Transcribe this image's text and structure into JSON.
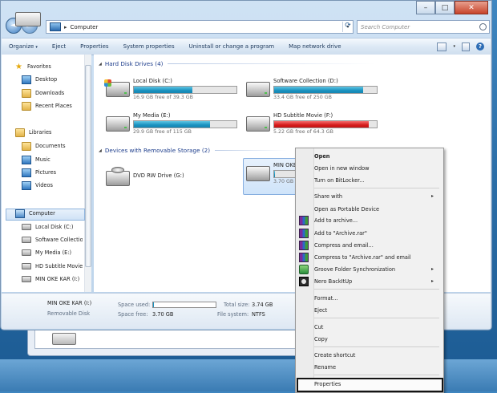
{
  "window": {
    "address": {
      "location": "Computer",
      "separator": "▸"
    },
    "search": {
      "placeholder": "Search Computer"
    },
    "controls": {
      "minimize": "–",
      "maximize": "□",
      "close": "✕"
    },
    "nav": {
      "back": "◄",
      "forward": "►"
    }
  },
  "command_bar": {
    "items": [
      "Organize",
      "Eject",
      "Properties",
      "System properties",
      "Uninstall or change a program",
      "Map network drive"
    ],
    "organize_caret": "▾"
  },
  "nav_pane": {
    "favorites": {
      "label": "Favorites",
      "items": [
        "Desktop",
        "Downloads",
        "Recent Places"
      ]
    },
    "libraries": {
      "label": "Libraries",
      "items": [
        "Documents",
        "Music",
        "Pictures",
        "Videos"
      ]
    },
    "computer": {
      "label": "Computer",
      "items": [
        "Local Disk (C:)",
        "Software Collection",
        "My Media (E:)",
        "HD Subtitle Movie",
        "MIN OKE KAR (I:)"
      ]
    }
  },
  "content": {
    "hard_disk_group": "Hard Disk Drives (4)",
    "removable_group": "Devices with Removable Storage (2)",
    "drives": [
      {
        "name": "Local Disk (C:)",
        "free": "16.9 GB free of 39.3 GB",
        "used_fraction": 0.57,
        "color": "#1a92c0"
      },
      {
        "name": "Software Collection (D:)",
        "free": "33.4 GB free of 250 GB",
        "used_fraction": 0.87,
        "color": "#1a92c0"
      },
      {
        "name": "My Media (E:)",
        "free": "29.9 GB free of 115 GB",
        "used_fraction": 0.74,
        "color": "#1a92c0"
      },
      {
        "name": "HD Subtitle Movie (F:)",
        "free": "5.22 GB free of 64.3 GB",
        "used_fraction": 0.92,
        "color": "#d51c1c"
      }
    ],
    "removable": [
      {
        "name": "DVD RW Drive (G:)"
      },
      {
        "name": "MIN OKE",
        "free": "3.70 GB"
      }
    ]
  },
  "details": {
    "name": "MIN OKE KAR (I:)",
    "type": "Removable Disk",
    "space_used_label": "Space used:",
    "space_free_label": "Space free:",
    "space_free": "3.70 GB",
    "total_size_label": "Total size:",
    "total_size": "3.74 GB",
    "file_system_label": "File system:",
    "file_system": "NTFS",
    "used_fraction": 0.01
  },
  "context_menu": {
    "items": [
      "Open",
      "Open in new window",
      "Turn on BitLocker...",
      "Share with",
      "Open as Portable Device",
      "Add to archive...",
      "Add to \"Archive.rar\"",
      "Compress and email...",
      "Compress to \"Archive.rar\" and email",
      "Groove Folder Synchronization",
      "Nero BackItUp",
      "Format...",
      "Eject",
      "Cut",
      "Copy",
      "Create shortcut",
      "Rename",
      "Properties"
    ],
    "submenu_arrow": "▸"
  }
}
